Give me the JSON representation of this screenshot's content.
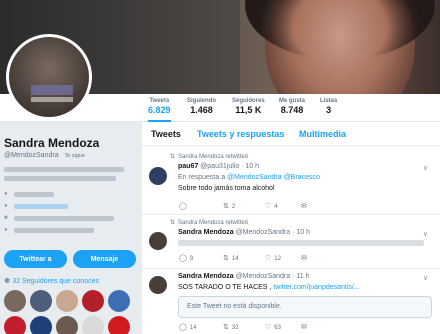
{
  "colors": {
    "accent": "#1da1f2",
    "muted": "#657786",
    "background": "#e6ecf0"
  },
  "stats": [
    {
      "label": "Tweets",
      "value": "6.829"
    },
    {
      "label": "Siguiendo",
      "value": "1.468"
    },
    {
      "label": "Seguidores",
      "value": "11,5 K"
    },
    {
      "label": "Me gusta",
      "value": "8.748"
    },
    {
      "label": "Listas",
      "value": "3"
    }
  ],
  "profile": {
    "name": "Sandra Mendoza",
    "handle": "@MendozSandra",
    "follows_badge": "Te sigue",
    "tweet_button": "Twittear a",
    "message_button": "Mensaje",
    "known_followers": "32 Seguidores que conoces",
    "meta_icons": [
      "location-icon",
      "link-icon",
      "calendar-icon",
      "balloon-icon"
    ]
  },
  "tabs": [
    "Tweets",
    "Tweets y respuestas",
    "Multimedia"
  ],
  "tweets": [
    {
      "retweet_label": "Sandra Mendoza retwitteó",
      "name": "pau67",
      "handle": "@pau31julio · 10 h",
      "reply_prefix": "En respuesta a",
      "reply_to": "@MendozSandra @Bracesco",
      "text": "Sobre todo jamás toma alcohol",
      "reply_count": "",
      "retweet_count": "2",
      "like_count": "4"
    },
    {
      "retweet_label": "Sandra Mendoza retwitteó",
      "name": "Sandra Mendoza",
      "handle": "@MendozSandra · 10 h",
      "reply_count": "9",
      "retweet_count": "14",
      "like_count": "12"
    },
    {
      "name": "Sandra Mendoza",
      "handle": "@MendozSandra · 11 h",
      "text": "SOS TARADO O TE HACES ,",
      "link": "twitter.com/juanpdesantis/...",
      "quote_unavailable": "Este Tweet no está disponible.",
      "reply_count": "14",
      "retweet_count": "32",
      "like_count": "63"
    }
  ]
}
